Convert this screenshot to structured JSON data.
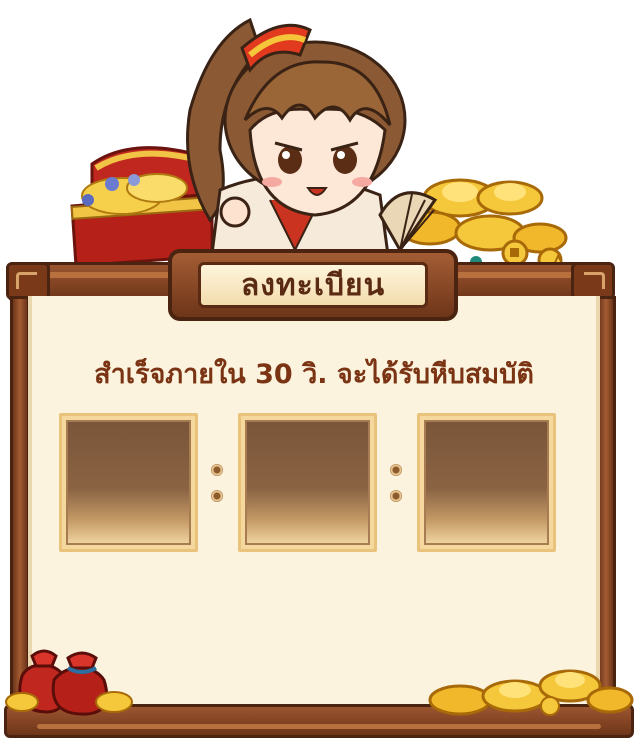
{
  "dialog": {
    "title": "ลงทะเบียน",
    "headline": "สำเร็จภายใน 30 วิ. จะได้รับหีบสมบัติ"
  },
  "reward_slots": [
    {
      "state": "empty"
    },
    {
      "state": "empty"
    },
    {
      "state": "empty"
    }
  ],
  "colors": {
    "frame_wood": "#7a3a1a",
    "panel_bg": "#fbf3de",
    "headline_text": "#7a3414",
    "slot_border": "#f4d89e",
    "gold": "#f3c53a"
  },
  "icons": {
    "character": "character-girl-with-fan-icon",
    "treasure_chest": "treasure-chest-icon",
    "gold_pile": "gold-ingot-pile-icon",
    "money_bag": "red-money-bag-icon",
    "connector": "slot-connector-dot-icon"
  }
}
